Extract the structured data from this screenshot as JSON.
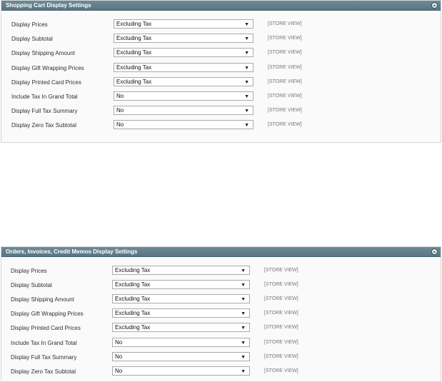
{
  "cart": {
    "title": "Shopping Cart Display Settings",
    "rows": [
      {
        "label": "Display Prices",
        "value": "Excluding Tax",
        "scope": "[STORE VIEW]"
      },
      {
        "label": "Display Subtotal",
        "value": "Excluding Tax",
        "scope": "[STORE VIEW]"
      },
      {
        "label": "Display Shipping Amount",
        "value": "Excluding Tax",
        "scope": "[STORE VIEW]"
      },
      {
        "label": "Display Gift Wrapping Prices",
        "value": "Excluding Tax",
        "scope": "[STORE VIEW]"
      },
      {
        "label": "Display Printed Card Prices",
        "value": "Excluding Tax",
        "scope": "[STORE VIEW]"
      },
      {
        "label": "Include Tax In Grand Total",
        "value": "No",
        "scope": "[STORE VIEW]"
      },
      {
        "label": "Display Full Tax Summary",
        "value": "No",
        "scope": "[STORE VIEW]"
      },
      {
        "label": "Display Zero Tax Subtotal",
        "value": "No",
        "scope": "[STORE VIEW]"
      }
    ]
  },
  "orders": {
    "title": "Orders, Invoices, Credit Memos Display Settings",
    "rows": [
      {
        "label": "Display Prices",
        "value": "Excluding Tax",
        "scope": "[STORE VIEW]"
      },
      {
        "label": "Display Subtotal",
        "value": "Excluding Tax",
        "scope": "[STORE VIEW]"
      },
      {
        "label": "Display Shipping Amount",
        "value": "Excluding Tax",
        "scope": "[STORE VIEW]"
      },
      {
        "label": "Display Gift Wrapping Prices",
        "value": "Excluding Tax",
        "scope": "[STORE VIEW]"
      },
      {
        "label": "Display Printed Card Prices",
        "value": "Excluding Tax",
        "scope": "[STORE VIEW]"
      },
      {
        "label": "Include Tax In Grand Total",
        "value": "No",
        "scope": "[STORE VIEW]"
      },
      {
        "label": "Display Full Tax Summary",
        "value": "No",
        "scope": "[STORE VIEW]"
      },
      {
        "label": "Display Zero Tax Subtotal",
        "value": "No",
        "scope": "[STORE VIEW]"
      }
    ]
  },
  "icons": {
    "collapse": "collapse-up-icon",
    "dropdown": "dropdown-arrow-icon"
  },
  "colors": {
    "header_bg": "#5f7d8a",
    "header_text": "#ffffff",
    "panel_bg": "#fafafa",
    "scope_text": "#777777"
  }
}
